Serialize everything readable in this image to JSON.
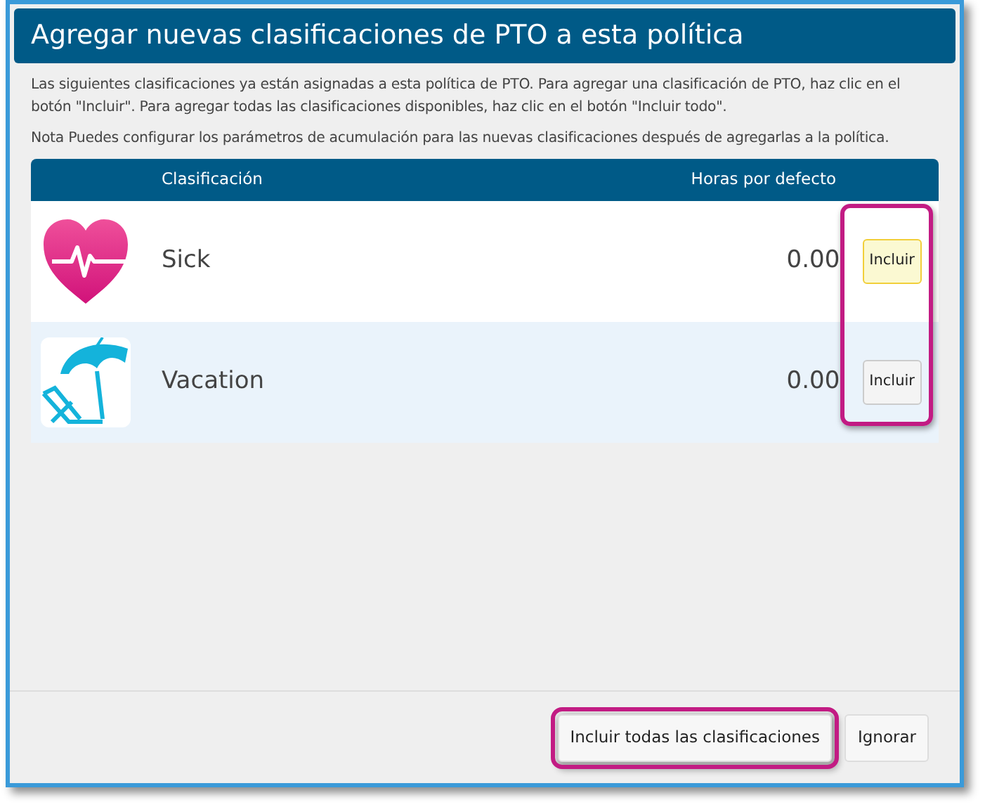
{
  "dialog": {
    "title": "Agregar nuevas clasificaciones de PTO a esta política",
    "intro": "Las siguientes clasificaciones ya están asignadas a esta política de PTO. Para agregar una clasificación de PTO, haz clic en el botón \"Incluir\". Para agregar todas las clasificaciones disponibles, haz clic en el botón \"Incluir todo\".",
    "note": "Nota Puedes configurar los parámetros de acumulación para las nuevas clasificaciones después de agregarlas a la política."
  },
  "table": {
    "columns": [
      "Clasificación",
      "Horas por defecto"
    ],
    "include_buttons_highlighted": true,
    "rows": [
      {
        "kind": "sick",
        "name": "Sick",
        "hours": "0.00",
        "button": "Incluir",
        "hovered": true
      },
      {
        "kind": "vacation",
        "name": "Vacation",
        "hours": "0.00",
        "button": "Incluir",
        "hovered": false
      }
    ]
  },
  "footer": {
    "buttons": [
      {
        "label": "Incluir todas las clasificaciones",
        "highlighted": true
      },
      {
        "label": "Ignorar",
        "highlighted": false
      }
    ]
  }
}
